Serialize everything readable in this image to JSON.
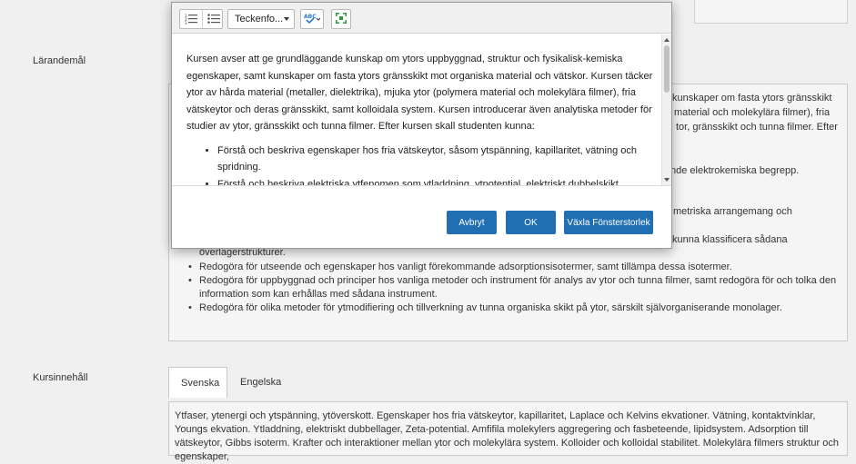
{
  "labels": {
    "larandemal": "Lärandemål",
    "kursinnehall": "Kursinnehåll"
  },
  "background": {
    "peek_lines": [
      "kunskaper om fasta ytors gränsskikt",
      "material och molekylära filmer), fria",
      "tor, gränsskikt och tunna filmer. Efter",
      "nde elektrokemiska begrepp.",
      "metriska arrangemang och",
      "kunna klassificera sådana"
    ],
    "continuation": "överlagerstrukturer.",
    "bullets": [
      "Redogöra för utseende och egenskaper hos vanligt förekommande adsorptionsisotermer, samt tillämpa dessa isotermer.",
      "Redogöra för uppbyggnad och principer hos vanliga metoder och instrument för analys av ytor och tunna filmer, samt redogöra för och tolka den information som kan erhållas med sådana instrument.",
      "Redogöra för olika metoder för ytmodifiering och tillverkning av tunna organiska skikt på ytor, särskilt självorganiserande monolager."
    ]
  },
  "tabs": [
    {
      "label": "Svenska"
    },
    {
      "label": "Engelska"
    }
  ],
  "course_content": "Ytfaser, ytenergi och ytspänning, ytöverskott. Egenskaper hos fria vätskeytor, kapillaritet, Laplace och Kelvins ekvationer. Vätning, kontaktvinklar, Youngs ekvation. Ytladdning, elektriskt dubbellager, Zeta-potential. Amfifila molekylers aggregering och fasbeteende, lipidsystem. Adsorption till vätskeytor, Gibbs isoterm. Krafter och interaktioner mellan ytor och molekylära system. Kolloider och kolloidal stabilitet. Molekylära filmers struktur och egenskaper,",
  "modal": {
    "toolbar": {
      "font_dropdown": "Teckenfo...",
      "icons": [
        "ordered-list-icon",
        "unordered-list-icon",
        "spellcheck-icon",
        "resize-icon"
      ]
    },
    "editor": {
      "paragraph": "Kursen avser att ge grundläggande kunskap om ytors uppbyggnad, struktur och fysikalisk-kemiska egenskaper, samt kunskaper om fasta ytors gränsskikt mot organiska material och vätskor. Kursen täcker ytor av hårda material (metaller, dielektrika), mjuka ytor (polymera material och molekylära filmer), fria vätskeytor och deras gränsskikt, samt kolloidala system. Kursen introducerar även analytiska metoder för studier av ytor, gränsskikt och tunna filmer. Efter kursen skall studenten kunna:",
      "bullets": [
        "Förstå och beskriva egenskaper hos fria vätskeytor, såsom ytspänning, kapillaritet, vätning och spridning.",
        "Förstå och beskriva elektriska ytfenomen som ytladdning, ytpotential, elektriskt dubbelskikt,"
      ]
    },
    "buttons": {
      "cancel": "Avbryt",
      "ok": "OK",
      "toggle_size": "Växla Fönsterstorlek"
    }
  },
  "colors": {
    "button_blue": "#1f6fb2",
    "spellcheck_icon": "#2a7bd0",
    "resize_icon": "#2e9a3a"
  }
}
